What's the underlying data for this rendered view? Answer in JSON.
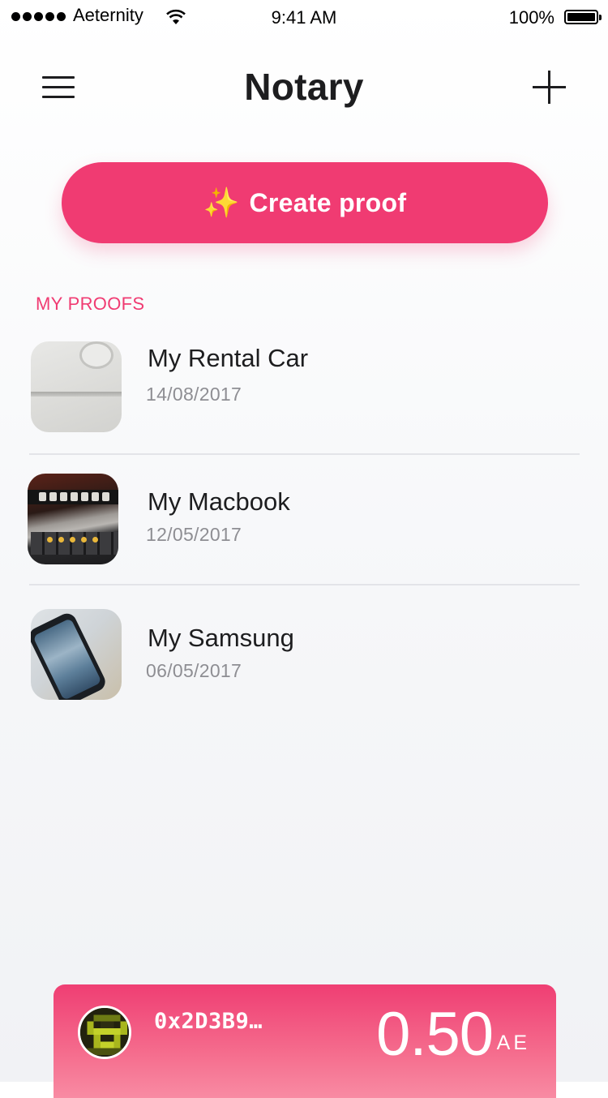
{
  "status_bar": {
    "carrier": "Aeternity",
    "time": "9:41 AM",
    "battery": "100%",
    "battery_level": 1.0
  },
  "header": {
    "title": "Notary",
    "menu_icon": "hamburger-menu-icon",
    "add_icon": "plus-icon"
  },
  "create_button": {
    "icon": "sparkles",
    "label": "Create proof",
    "color": "#f03b72"
  },
  "proofs": {
    "section_title": "MY PROOFS",
    "items": [
      {
        "title": "My Rental Car",
        "date": "14/08/2017",
        "thumbnail": "car-door-photo"
      },
      {
        "title": "My Macbook",
        "date": "12/05/2017",
        "thumbnail": "macbook-keyboard-photo"
      },
      {
        "title": "My Samsung",
        "date": "06/05/2017",
        "thumbnail": "samsung-phone-photo"
      }
    ]
  },
  "wallet": {
    "address": "0x2D3B9…",
    "balance": "0.50",
    "unit": "AE",
    "avatar_icon": "pixel-identicon-avatar"
  },
  "colors": {
    "accent": "#f03b72",
    "text_primary": "#1d1d1f",
    "text_secondary": "#8e8e93"
  }
}
